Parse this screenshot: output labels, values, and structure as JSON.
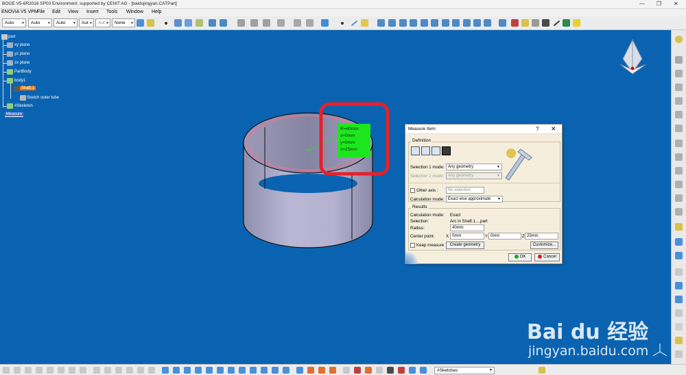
{
  "window": {
    "title": "BOGE V5-6R2016 SP03 Environment: supported by CENIT AG - [baidujingyan.CATPart]",
    "controls": [
      "—",
      "❐",
      "✕"
    ]
  },
  "menu": [
    "ENOVIA V5 VPM",
    "File",
    "Edit",
    "View",
    "Insert",
    "Tools",
    "Window",
    "Help"
  ],
  "toolbar": {
    "combos": [
      "Auto",
      "Auto",
      "Auto",
      "Aut",
      "Aut",
      "None"
    ]
  },
  "tree": {
    "root": "part",
    "items": [
      "xy plane",
      "yz plane",
      "zx plane",
      "PartBody",
      "body1",
      "Shaft.1",
      "Sketch outer tube",
      "#Skeleton",
      "Measure"
    ]
  },
  "measure_label": {
    "lines": [
      "R=40mm",
      "x=0mm",
      "y=0mm",
      "z=25mm"
    ]
  },
  "dialog": {
    "title": "Measure Item",
    "help": "?",
    "close": "✕",
    "definition": {
      "label": "Definition",
      "sel1_label": "Selection 1 mode:",
      "sel1_value": "Any geometry",
      "sel2_label": "Selection 2 mode:",
      "sel2_value": "Any geometry",
      "other_axis_label": "Other axis :",
      "other_axis_value": "No selection",
      "calc_mode_label": "Calculation mode:",
      "calc_mode_value": "Exact else approximate"
    },
    "results": {
      "label": "Results",
      "calc_mode_label": "Calculation mode:",
      "calc_mode_value": "Exact",
      "selection_label": "Selection:",
      "selection_value": "Arc in Shaft.1....part",
      "radius_label": "Radius:",
      "radius_value": "40mm",
      "center_label": "Center point:",
      "x_label": "X",
      "x_value": "0mm",
      "y_label": "Y",
      "y_value": "0mm",
      "z_label": "Z",
      "z_value": "25mm"
    },
    "keep_measure": "Keep measure",
    "create_geometry": "Create geometry",
    "customize": "Customize...",
    "ok": "OK",
    "cancel": "Cancel"
  },
  "status": {
    "input_value": "#Sketches"
  },
  "watermark": {
    "brand": "Bai  du 经验",
    "url": "jingyan.baidu.com"
  },
  "colors": {
    "viewport": "#0a63b0",
    "measure_box": "#1ee61e",
    "highlight": "#e8202a",
    "selection": "#ff7a00"
  }
}
